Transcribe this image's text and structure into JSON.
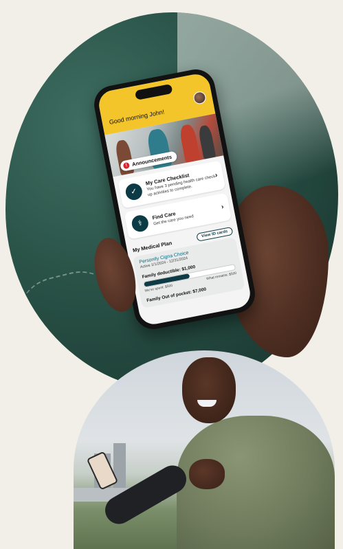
{
  "app": {
    "greeting": "Good morning John!",
    "announcements_label": "Announcements",
    "announcements_icon": "alert-icon",
    "cards": [
      {
        "icon": "checklist-icon",
        "title": "My Care Checklist",
        "description": "You have 3 pending health care check-up activities to complete."
      },
      {
        "icon": "stethoscope-icon",
        "title": "Find Care",
        "description": "Get the care you need"
      }
    ],
    "medical_plan": {
      "section_title": "My Medical Plan",
      "view_id_label": "View ID cards",
      "plan_name": "Personify Cigna Choice",
      "plan_dates": "Active 1/1/2024 - 12/31/2024",
      "deductible_label": "Family deductible: $1,000",
      "deductible_progress": 0.5,
      "spent_label": "We've spent: $500",
      "remains_label": "What remains: $500",
      "oop_label": "Family Out of pocket: $7,000"
    }
  },
  "colors": {
    "brand_yellow": "#f3c52b",
    "brand_dark": "#0d3b45",
    "link_blue": "#0a6a80",
    "alert_red": "#d7262e"
  }
}
